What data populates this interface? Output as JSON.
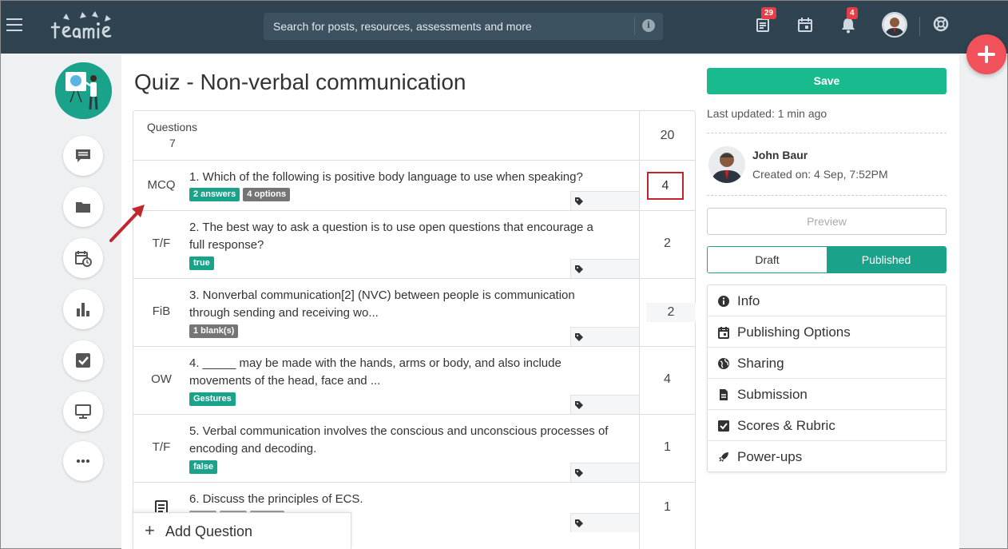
{
  "topbar": {
    "search_placeholder": "Search for posts, resources, assessments and more",
    "info_glyph": "i",
    "badges": {
      "newsfeed": "29",
      "notifications": "4"
    }
  },
  "rail": [
    "chat-icon",
    "folder-icon",
    "calendar-clock-icon",
    "bar-chart-icon",
    "checkbox-icon",
    "monitor-icon",
    "more-icon"
  ],
  "quiz": {
    "title": "Quiz - Non-verbal communication",
    "questions_label": "Questions",
    "questions_count": "7",
    "total_marks": "20",
    "questions": [
      {
        "type": "MCQ",
        "line1": "1. Which of the following is positive body language to use when speaking?",
        "line2": "",
        "tags": [
          "2 answers",
          "4 options"
        ],
        "marks": "4"
      },
      {
        "type": "T/F",
        "line1": "2. The best way to ask a question is to use open questions that encourage a",
        "line2": "full response?",
        "tags": [
          "true"
        ],
        "marks": "2"
      },
      {
        "type": "FiB",
        "line1": "3. Nonverbal communication[2] (NVC) between people is communication",
        "line2": "through sending and receiving wo...",
        "tags": [
          "1 blank(s)"
        ],
        "marks": "2"
      },
      {
        "type": "OW",
        "line1": "4. _____ may be made with the hands, arms or body, and also include",
        "line2": "movements of the head, face and ...",
        "tags": [
          "Gestures"
        ],
        "marks": "4"
      },
      {
        "type": "T/F",
        "line1": "5. Verbal communication involves the conscious and unconscious processes of",
        "line2": "encoding and decoding.",
        "tags": [
          "false"
        ],
        "marks": "1"
      },
      {
        "type": "",
        "line1": "6. Discuss the principles of ECS.",
        "line2": "",
        "tags": [],
        "marks": "1"
      }
    ],
    "add_question": "Add Question"
  },
  "sidebar": {
    "save": "Save",
    "last_updated": "Last updated: 1 min ago",
    "author_name": "John Baur",
    "created_on": "Created on: 4 Sep, 7:52PM",
    "preview": "Preview",
    "status_draft": "Draft",
    "status_published": "Published",
    "menu": [
      "Info",
      "Publishing Options",
      "Sharing",
      "Submission",
      "Scores & Rubric",
      "Power-ups"
    ]
  },
  "colors": {
    "topbar": "#2f4350",
    "accent": "#1aa38a",
    "save": "#1aba8f",
    "fab": "#f0515b",
    "highlight": "#c0272d"
  }
}
